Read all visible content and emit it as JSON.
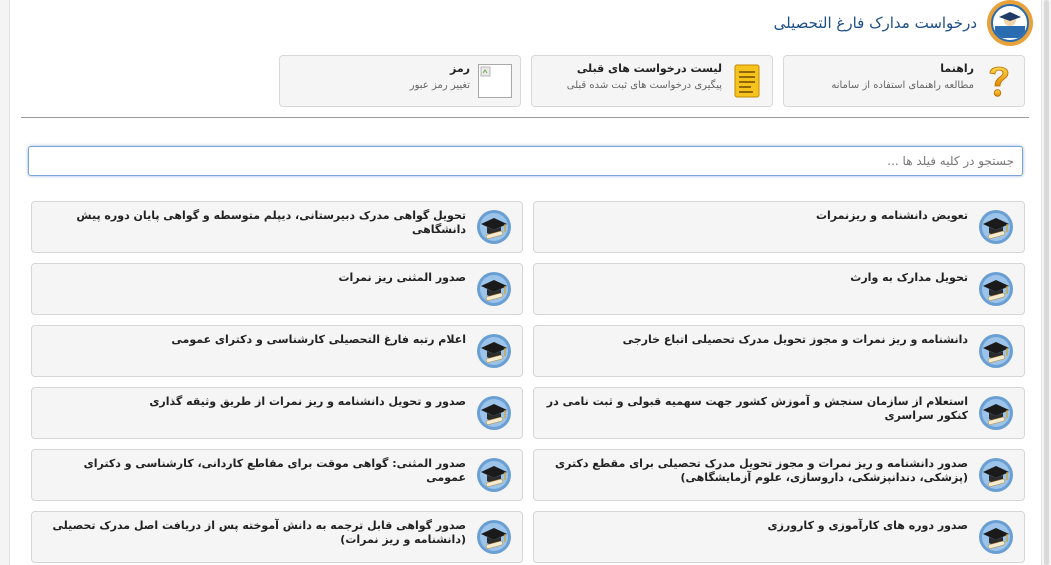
{
  "header": {
    "title": "درخواست مدارک فارغ التحصیلی",
    "logo_icon": "university-seal-icon"
  },
  "top_cards": [
    {
      "title": "راهنما",
      "desc": "مطالعه راهنمای استفاده از سامانه",
      "icon": "question-mark-icon"
    },
    {
      "title": "لیست درخواست های قبلی",
      "desc": "پیگیری درخواست های ثبت شده قبلی",
      "icon": "document-list-icon"
    },
    {
      "title": "رمز",
      "desc": "تغییر رمز عبور",
      "icon": "broken-image-icon"
    }
  ],
  "search": {
    "placeholder": "جستجو در کلیه فیلد ها ..."
  },
  "items": [
    {
      "label": "تعویض دانشنامه و ریزنمرات"
    },
    {
      "label": "تحویل گواهی مدرک دبیرستانی، دیپلم متوسطه و گواهی پایان دوره پیش دانشگاهی"
    },
    {
      "label": "تحویل مدارک به وارث"
    },
    {
      "label": "صدور المثنی ریز نمرات"
    },
    {
      "label": "دانشنامه و ریز نمرات و مجوز تحویل مدرک تحصیلی اتباع خارجی"
    },
    {
      "label": "اعلام رتبه فارغ التحصیلی کارشناسی و دکترای عمومی"
    },
    {
      "label": "استعلام از سازمان سنجش و آموزش کشور جهت سهمیه قبولی و ثبت نامی در کنکور سراسری"
    },
    {
      "label": "صدور و تحویل دانشنامه و ریز نمرات از طریق وثیقه گذاری"
    },
    {
      "label": "صدور دانشنامه و ریز نمرات و مجوز تحویل مدرک تحصیلی برای مقطع دکتری (پزشکی، دندانپزشکی، داروسازی، علوم آزمایشگاهی)"
    },
    {
      "label": "صدور المثنی: گواهی موقت برای مقاطع کاردانی، کارشناسی و دکترای عمومی"
    },
    {
      "label": "صدور دوره های کارآموزی و کارورزی"
    },
    {
      "label": "صدور گواهی قابل ترجمه به دانش آموخته پس از دریافت اصل مدرک تحصیلی (دانشنامه و ریز نمرات)"
    }
  ],
  "item_icon": "graduation-cap-icon"
}
